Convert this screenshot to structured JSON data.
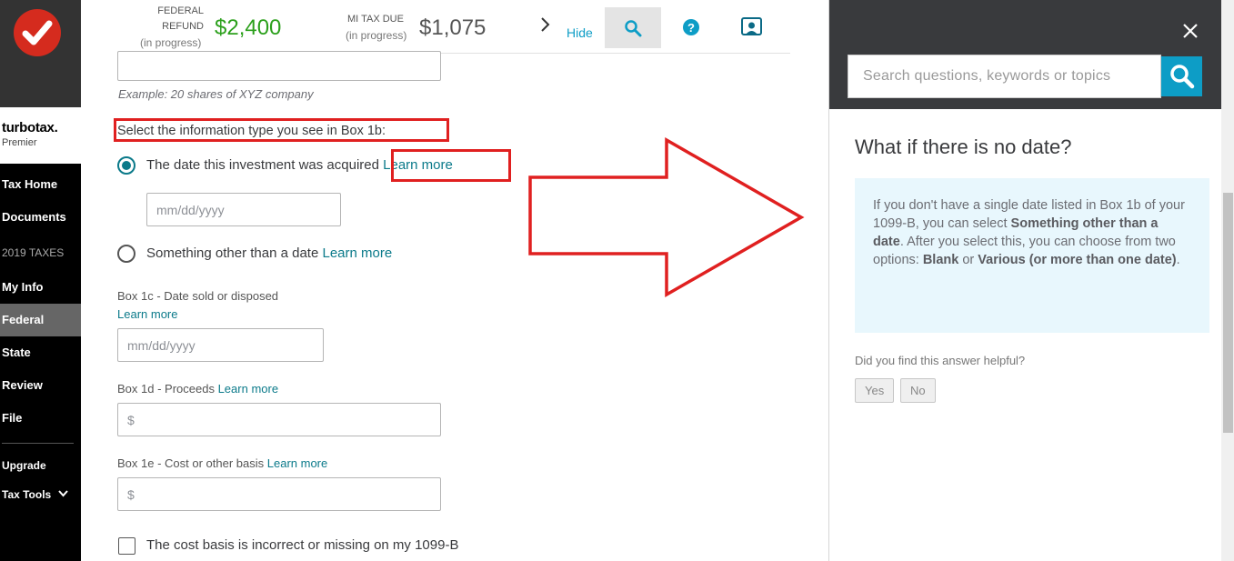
{
  "nav": {
    "brand": "turbotax.",
    "edition": "Premier",
    "items": [
      {
        "label": "Tax Home"
      },
      {
        "label": "Documents"
      },
      {
        "label": "My Info"
      },
      {
        "label": "Federal"
      },
      {
        "label": "State"
      },
      {
        "label": "Review"
      },
      {
        "label": "File"
      }
    ],
    "section_label": "2019 TAXES",
    "upgrade": "Upgrade",
    "tax_tools": "Tax Tools"
  },
  "header": {
    "federal_label_1": "FEDERAL",
    "federal_label_2": "REFUND",
    "federal_status": "(in progress)",
    "federal_amount": "$2,400",
    "state_label": "MI TAX DUE",
    "state_status": "(in progress)",
    "state_amount": "$1,075",
    "hide": "Hide"
  },
  "form": {
    "example": "Example: 20 shares of XYZ company",
    "box1b_question": "Select the information type you see in Box 1b:",
    "option_date": "The date this investment was acquired",
    "option_other": "Something other than a date",
    "learn_more": "Learn more",
    "date_placeholder": "mm/dd/yyyy",
    "box1c_label": "Box 1c - Date sold or disposed",
    "box1d_label": "Box 1d - Proceeds",
    "box1e_label": "Box 1e - Cost or other basis",
    "currency": "$",
    "cost_basis_checkbox": "The cost basis is incorrect or missing on my 1099-B"
  },
  "help": {
    "search_placeholder": "Search questions, keywords or topics",
    "title": "What if there is no date?",
    "answer_p1": "If you don't have a single date listed in Box 1b of your 1099-B, you can select ",
    "answer_b1": "Something other than a date",
    "answer_p2": ". After you select this, you can choose from two options: ",
    "answer_b2": "Blank",
    "answer_p3": " or ",
    "answer_b3": "Various (or more than one date)",
    "answer_p4": ".",
    "helpful_q": "Did you find this answer helpful?",
    "yes": "Yes",
    "no": "No"
  },
  "colors": {
    "accent_teal": "#0b7a8a",
    "refund_green": "#2ca01c",
    "annotation_red": "#e02020",
    "search_blue": "#0d9dc6"
  }
}
